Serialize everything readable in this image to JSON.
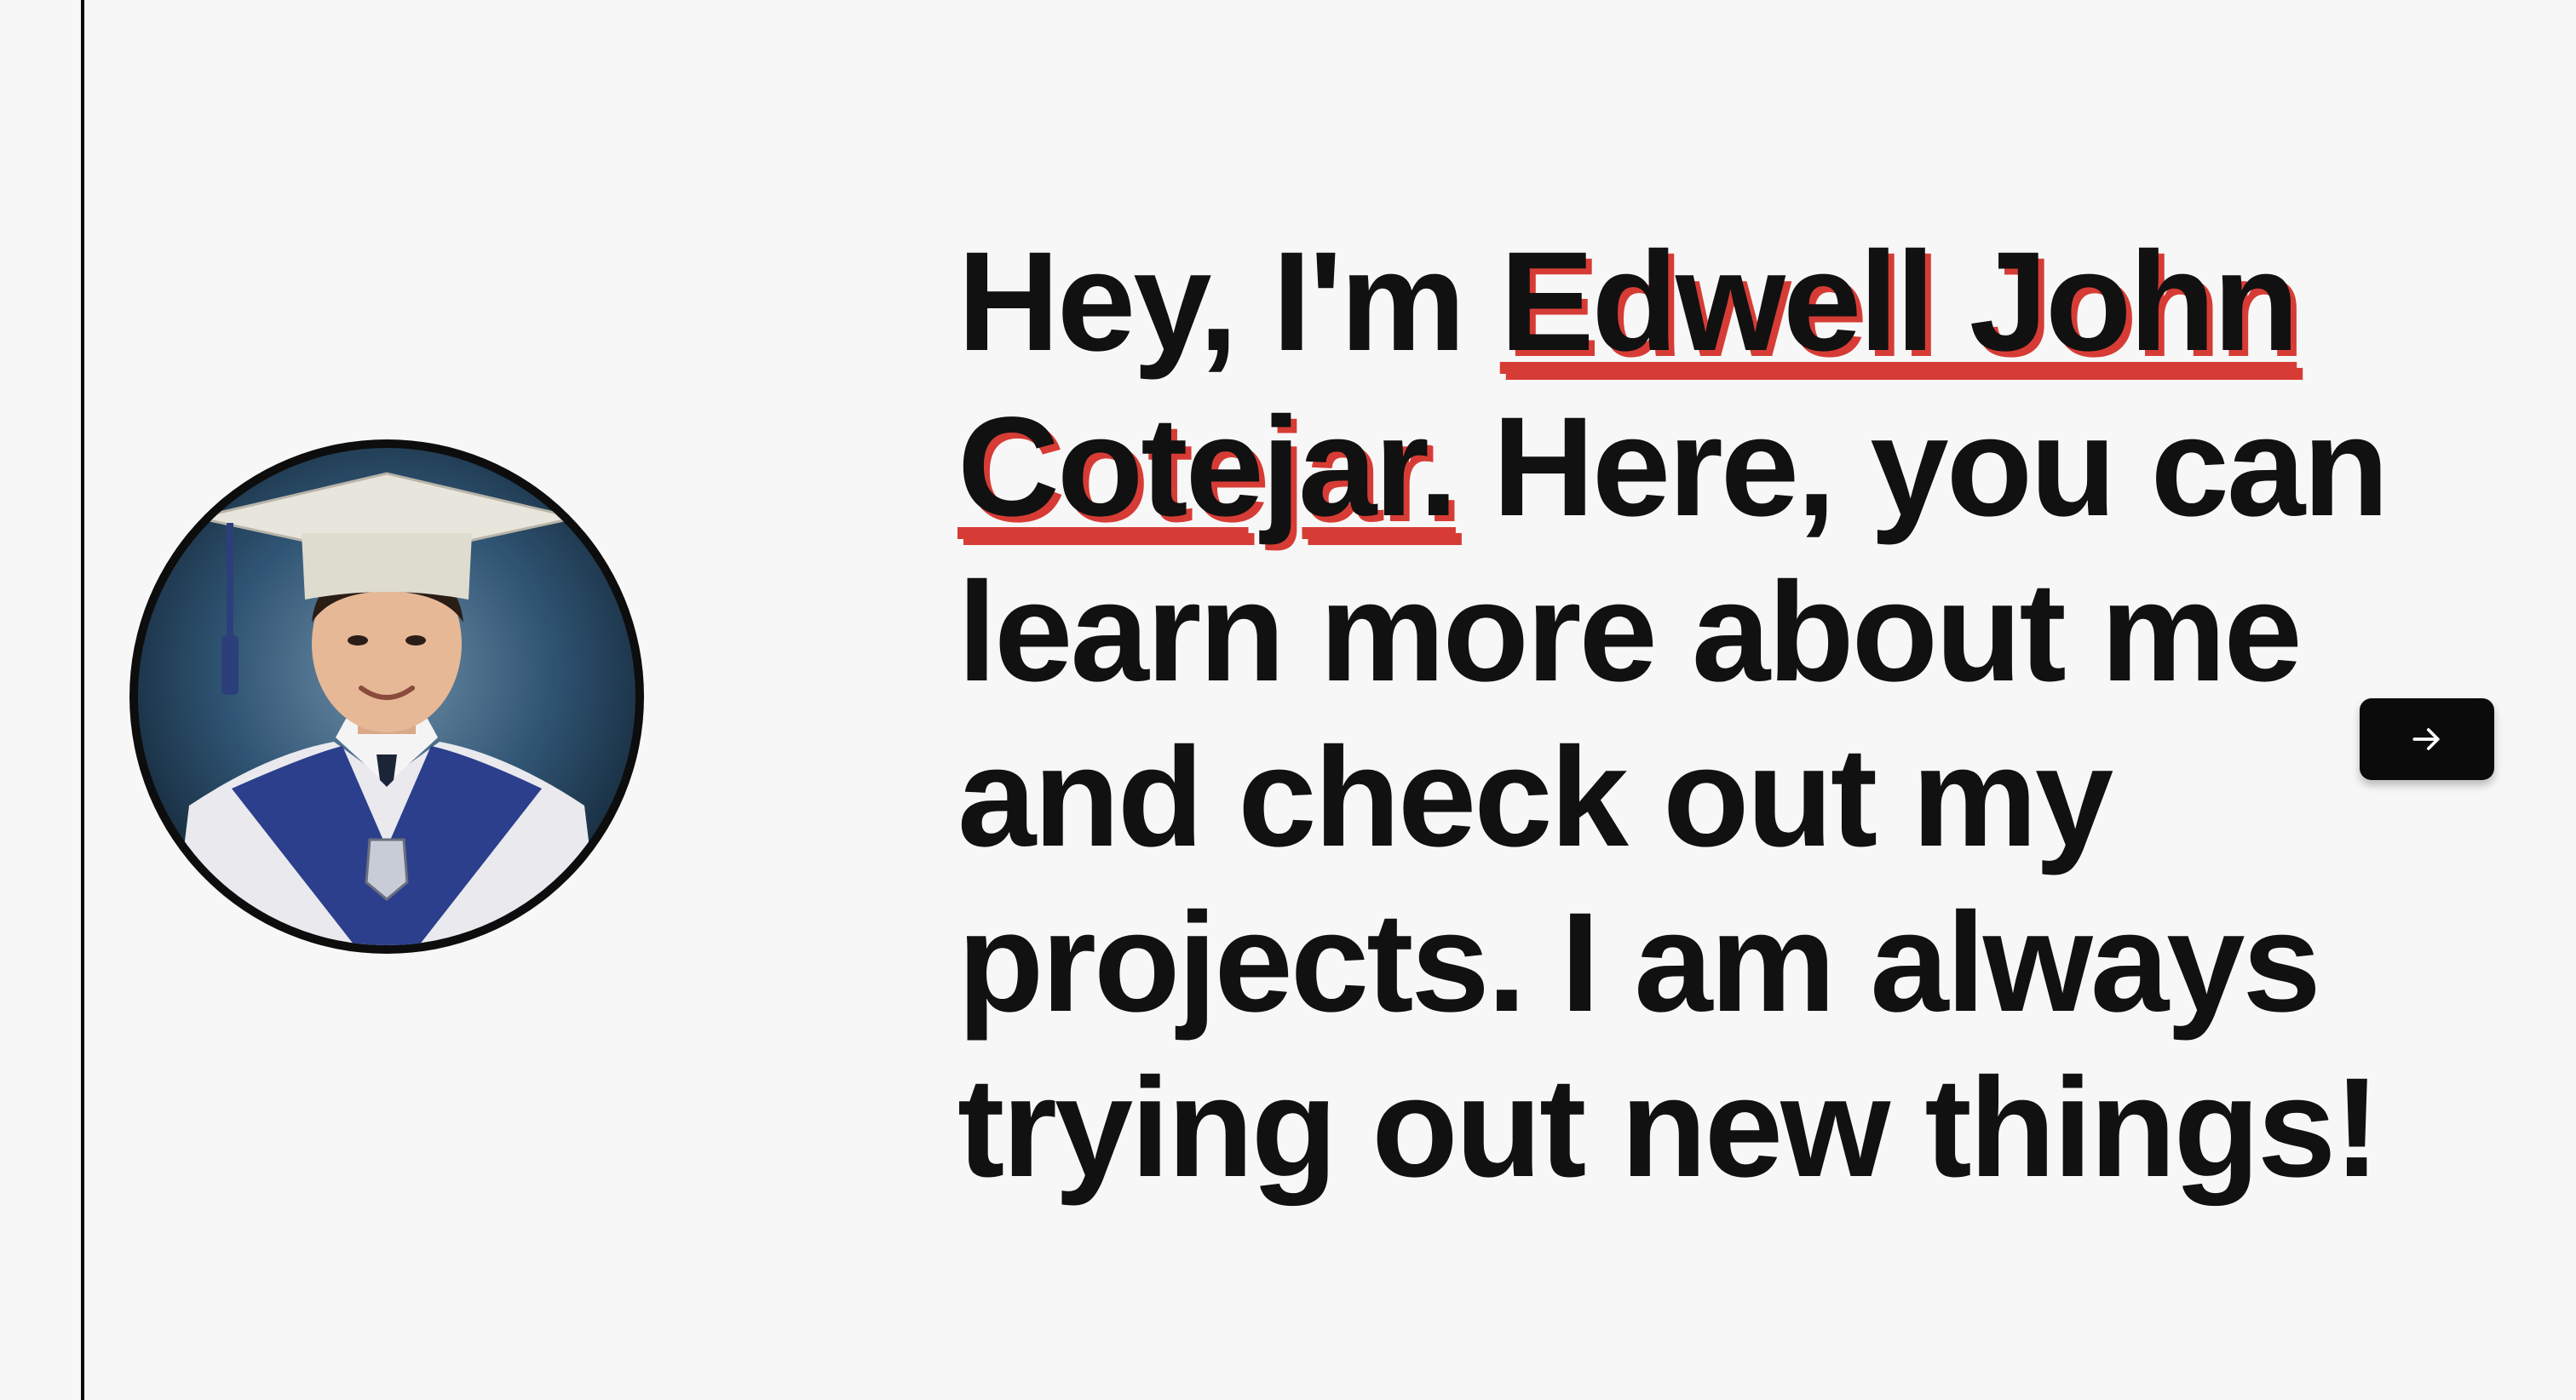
{
  "intro": {
    "greeting": "Hey, I'm ",
    "name": "Edwell John Cotejar.",
    "body": " Here, you can learn more about me and check out my projects. I am always trying out new things!"
  },
  "next_button": {
    "icon": "arrow-right-icon"
  },
  "colors": {
    "background": "#f7f7f7",
    "text": "#111111",
    "accent": "#d63c35",
    "button": "#0b0b0b"
  }
}
